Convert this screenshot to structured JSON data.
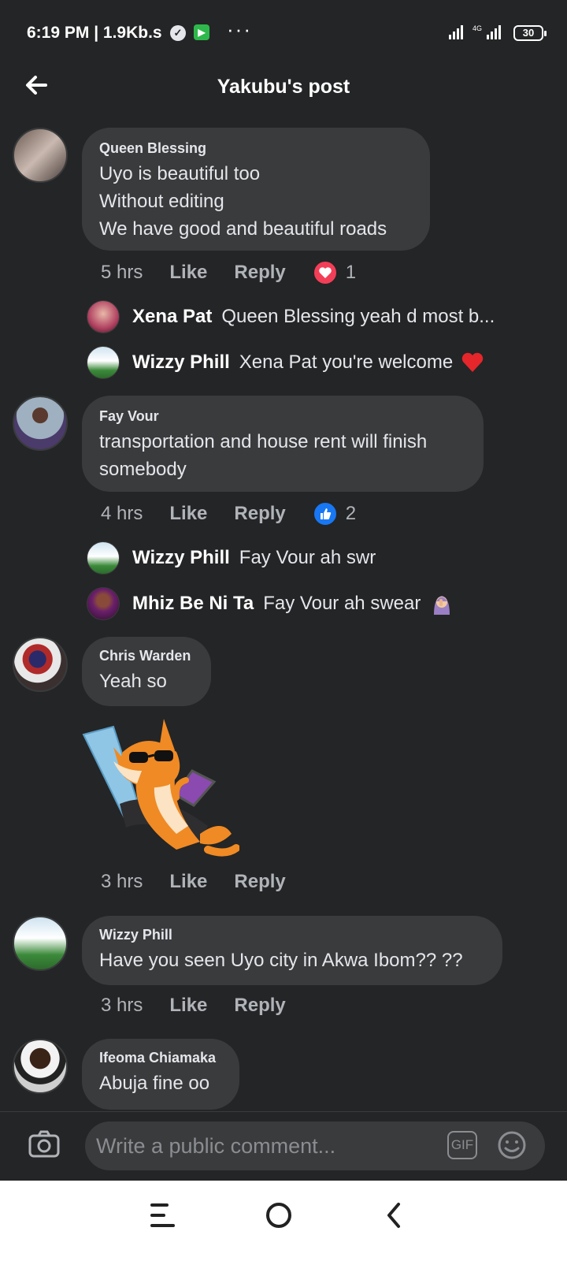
{
  "status_bar": {
    "time": "6:19 PM | 1.9Kb.s",
    "battery": "30",
    "network": "4G"
  },
  "header": {
    "title": "Yakubu's post"
  },
  "comments": [
    {
      "name": "Queen Blessing",
      "text": "Uyo is beautiful too\nWithout editing\nWe have good and beautiful roads",
      "time": "5 hrs",
      "like": "Like",
      "reply": "Reply",
      "reaction_count": "1",
      "replies": [
        {
          "name": "Xena Pat",
          "text": "Queen Blessing yeah d most b..."
        },
        {
          "name": "Wizzy Phill",
          "text": "Xena Pat you're welcome"
        }
      ]
    },
    {
      "name": "Fay Vour",
      "text": "transportation and house rent will finish\nsomebody",
      "time": "4 hrs",
      "like": "Like",
      "reply": "Reply",
      "reaction_count": "2",
      "replies": [
        {
          "name": "Wizzy Phill",
          "text": "Fay Vour ah swr"
        },
        {
          "name": "Mhiz Be Ni Ta",
          "text": "Fay Vour ah swear"
        }
      ]
    },
    {
      "name": "Chris Warden",
      "text": "Yeah so",
      "time": "3 hrs",
      "like": "Like",
      "reply": "Reply"
    },
    {
      "name": "Wizzy Phill",
      "text": "Have you seen Uyo city in Akwa Ibom?? ??",
      "time": "3 hrs",
      "like": "Like",
      "reply": "Reply"
    },
    {
      "name": "Ifeoma Chiamaka",
      "text": "Abuja fine oo"
    }
  ],
  "composer": {
    "placeholder": "Write a public comment...",
    "gif": "GIF"
  },
  "colors": {
    "background": "#242526",
    "bubble": "#3a3b3c",
    "like_blue": "#1877f2",
    "love_red": "#f33e58"
  }
}
